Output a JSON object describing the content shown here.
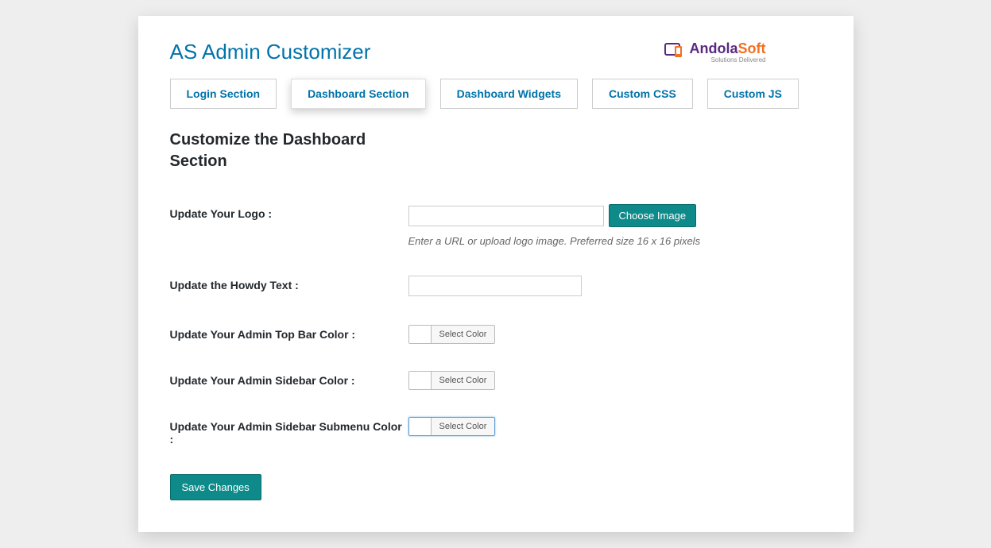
{
  "header": {
    "title": "AS Admin Customizer",
    "brand_a": "Andola",
    "brand_b": "Soft",
    "brand_tag": "Solutions Delivered"
  },
  "tabs": {
    "login": "Login Section",
    "dashboard": "Dashboard Section",
    "widgets": "Dashboard Widgets",
    "css": "Custom CSS",
    "js": "Custom JS"
  },
  "section_title": "Customize the Dashboard Section",
  "fields": {
    "logo": {
      "label": "Update Your Logo :",
      "value": "",
      "button": "Choose Image",
      "help": "Enter a URL or upload logo image. Preferred size 16 x 16 pixels"
    },
    "howdy": {
      "label": "Update the Howdy Text :",
      "value": ""
    },
    "topbar": {
      "label": "Update Your Admin Top Bar Color :",
      "button": "Select Color"
    },
    "sidebar": {
      "label": "Update Your Admin Sidebar Color :",
      "button": "Select Color"
    },
    "submenu": {
      "label": "Update Your Admin Sidebar Submenu Color :",
      "button": "Select Color"
    }
  },
  "save_label": "Save Changes"
}
